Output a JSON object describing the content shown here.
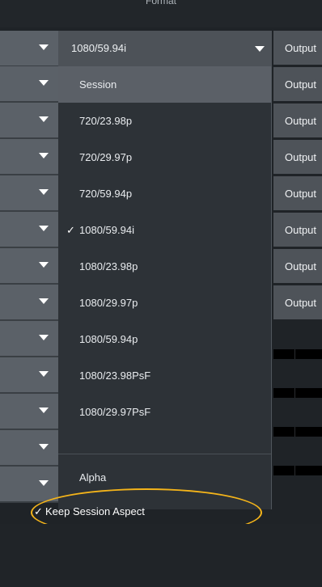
{
  "header": {
    "title": "Format"
  },
  "top_select": {
    "value": "1080/59.94i"
  },
  "menu": {
    "items": [
      {
        "label": "Session",
        "checked": false,
        "highlighted": true
      },
      {
        "label": "720/23.98p",
        "checked": false
      },
      {
        "label": "720/29.97p",
        "checked": false
      },
      {
        "label": "720/59.94p",
        "checked": false
      },
      {
        "label": "1080/59.94i",
        "checked": true
      },
      {
        "label": "1080/23.98p",
        "checked": false
      },
      {
        "label": "1080/29.97p",
        "checked": false
      },
      {
        "label": "1080/59.94p",
        "checked": false
      },
      {
        "label": "1080/23.98PsF",
        "checked": false
      },
      {
        "label": "1080/29.97PsF",
        "checked": false
      },
      {
        "label": "Alpha",
        "checked": false
      }
    ],
    "keep_session_aspect": {
      "label": "Keep Session Aspect",
      "checked": true
    },
    "check_glyph": "✓"
  },
  "right_buttons": [
    {
      "label": "Output"
    },
    {
      "label": "Output"
    },
    {
      "label": "Output"
    },
    {
      "label": "Output"
    },
    {
      "label": "Output"
    },
    {
      "label": "Output"
    },
    {
      "label": "Output"
    },
    {
      "label": "Output"
    }
  ],
  "colors": {
    "background": "#1f2327",
    "menu_bg": "#2d3237",
    "highlight": "#5b6067",
    "annotation_ellipse": "#f4b41a"
  }
}
